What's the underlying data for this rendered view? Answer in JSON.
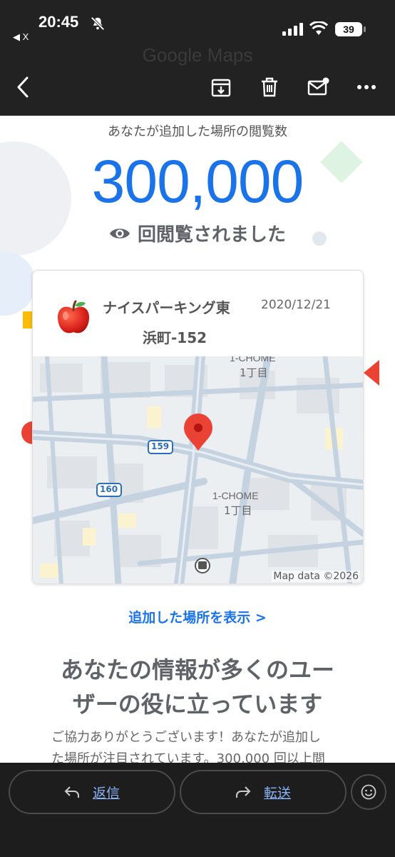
{
  "status_bar": {
    "time": "20:45",
    "back_app": "◀ X",
    "battery": "39"
  },
  "header": {
    "watermark": "Google Maps",
    "icons": [
      "back-icon",
      "archive-icon",
      "trash-icon",
      "mark-unread-icon",
      "more-icon"
    ]
  },
  "email": {
    "views_label": "あなたが追加した場所の閲覧数",
    "views_count": "300,000",
    "views_suffix": "回閲覧されました",
    "place": {
      "name_line1": "ナイスパーキング東",
      "name_line2": "浜町-152",
      "date": "2020/12/21",
      "icon": "apple-icon"
    },
    "map": {
      "labels": [
        "1-CHOME",
        "1丁目",
        "159",
        "160",
        "1-CHOME",
        "1丁目"
      ],
      "attribution": "Map data ©2026"
    },
    "view_places_link": "追加した場所を表示 >",
    "headline_line1": "あなたの情報が多くのユー",
    "headline_line2": "ザーの役に立っています",
    "body_line1": "ご協力ありがとうございます！あなたが追加し",
    "body_line2": "た場所が注目されています。300,000 回以上閲"
  },
  "bottom_bar": {
    "reply_label": "返信",
    "forward_label": "転送"
  },
  "colors": {
    "accent": "#1a73e8",
    "topbar": "#222222",
    "bottombar": "#1d1d1d",
    "pin": "#ea4335"
  }
}
